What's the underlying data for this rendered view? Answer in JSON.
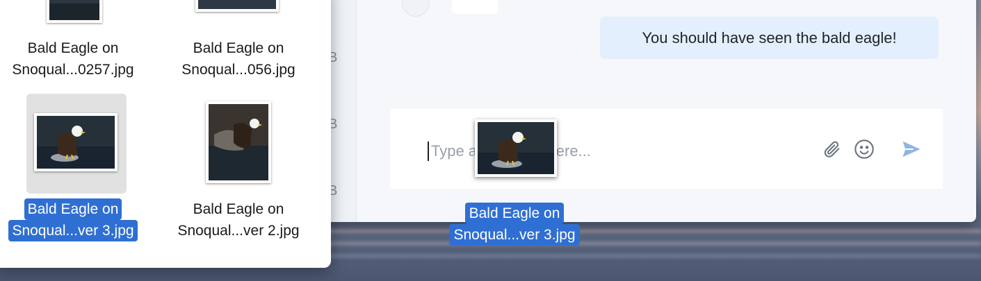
{
  "chat": {
    "sidebar_sizes": [
      "B",
      "B",
      "B"
    ],
    "message": "You should have seen the bald eagle!",
    "composer": {
      "placeholder": "Type a message here..."
    },
    "icons": [
      "paperclip-icon",
      "smiley-icon",
      "send-icon"
    ]
  },
  "finder": {
    "files": [
      {
        "line1": "Bald Eagle on",
        "line2": "Snoqual...0257.jpg"
      },
      {
        "line1": "Bald Eagle on",
        "line2": "Snoqual...056.jpg"
      },
      {
        "line1": "Bald Eagle on",
        "line2": "Snoqual...ver 3.jpg",
        "selected": true
      },
      {
        "line1": "Bald Eagle on",
        "line2": "Snoqual...ver 2.jpg"
      }
    ]
  },
  "drag": {
    "line1": "Bald Eagle on",
    "line2": "Snoqual...ver 3.jpg"
  },
  "colors": {
    "selection": "#2f6fd3",
    "bubble": "#e3effc",
    "send": "#8fb6e0"
  }
}
